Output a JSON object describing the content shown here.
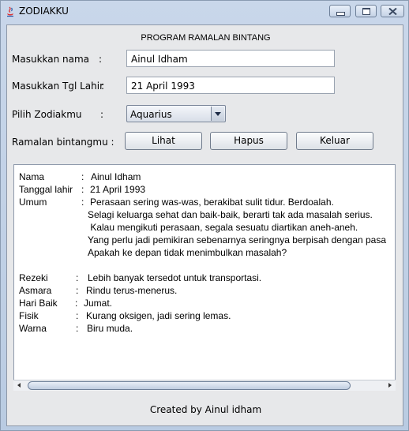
{
  "window": {
    "title": "ZODIAKKU"
  },
  "header": "PROGRAM RAMALAN BINTANG",
  "form": {
    "name_label": "Masukkan nama",
    "name_colon": ":",
    "name_value": "Ainul Idham",
    "dob_label": "Masukkan Tgl Lahir",
    "dob_colon": ":",
    "dob_value": "21 April 1993",
    "zodiac_label": "Pilih Zodiakmu",
    "zodiac_colon": ":",
    "zodiac_selected": "Aquarius",
    "forecast_label": "Ramalan bintangmu :"
  },
  "buttons": {
    "lihat": "Lihat",
    "hapus": "Hapus",
    "keluar": "Keluar"
  },
  "result": {
    "rows": [
      {
        "key": "Nama",
        "colon": ":",
        "value": "Ainul Idham"
      },
      {
        "key": "Tanggal lahir",
        "colon": ":",
        "value": "21 April 1993"
      },
      {
        "key": "Umum",
        "colon": ":",
        "value": "Perasaan sering was-was, berakibat sulit tidur. Berdoalah."
      },
      {
        "key": "",
        "colon": "",
        "value": "Selagi keluarga sehat dan baik-baik, berarti tak ada masalah serius."
      },
      {
        "key": "",
        "colon": "",
        "value": " Kalau mengikuti perasaan, segala sesuatu diartikan aneh-aneh."
      },
      {
        "key": "",
        "colon": "",
        "value": "Yang perlu jadi pemikiran sebenarnya seringnya berpisah dengan pasa"
      },
      {
        "key": "",
        "colon": "",
        "value": "Apakah ke depan tidak menimbulkan masalah?"
      },
      {
        "key": "Rezeki",
        "colon": ":",
        "value": "Lebih banyak tersedot untuk transportasi."
      },
      {
        "key": "Asmara",
        "colon": ":",
        "value": "Rindu terus-menerus."
      },
      {
        "key": "Hari Baik",
        "colon": ":",
        "value": "Jumat."
      },
      {
        "key": "Fisik",
        "colon": ":",
        "value": "Kurang oksigen, jadi sering lemas."
      },
      {
        "key": "Warna",
        "colon": ":",
        "value": "Biru muda."
      }
    ]
  },
  "footer": "Created by Ainul idham",
  "colors": {
    "titlebar": "#c9d7ea",
    "panel": "#e7e8ea"
  }
}
